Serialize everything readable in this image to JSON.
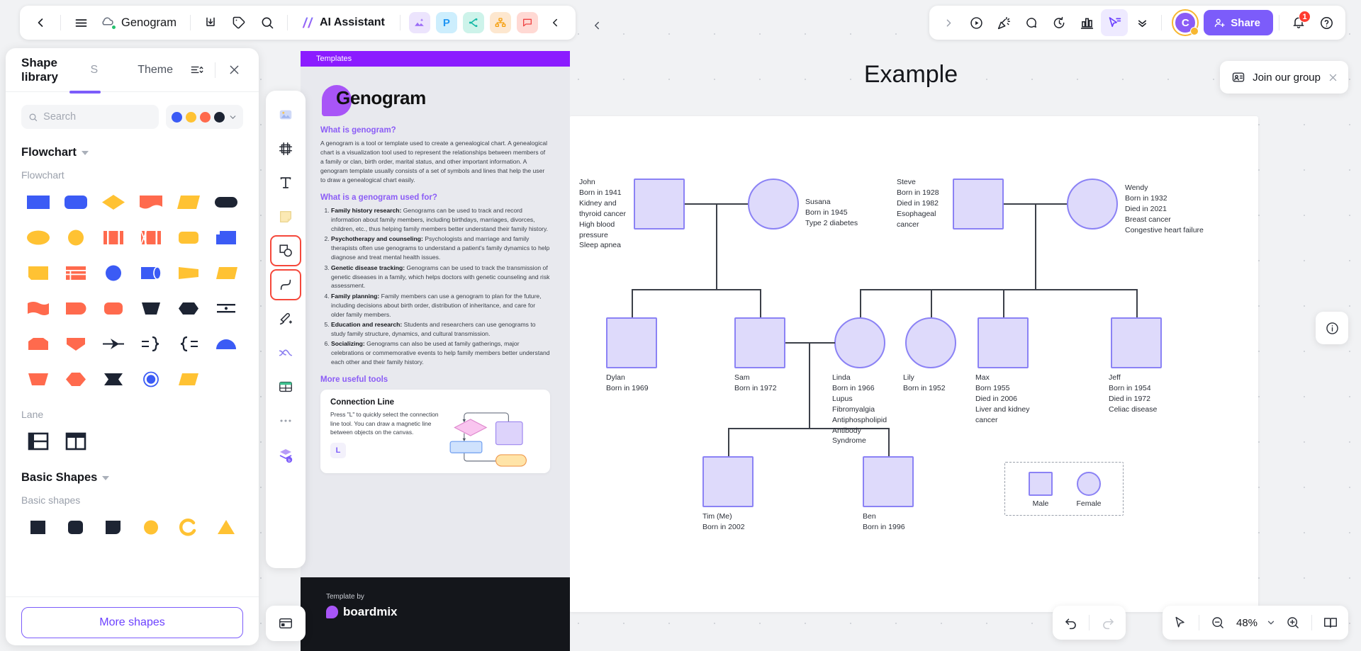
{
  "topbar": {
    "back_icon": "chevron-left-icon",
    "menu_icon": "hamburger-menu-icon",
    "cloud_icon": "cloud-saved-icon",
    "doc_title": "Genogram",
    "download_icon": "download-icon",
    "tag_icon": "tag-icon",
    "search_icon": "search-icon",
    "ai_label": "AI Assistant",
    "apps": [
      {
        "name": "image-app-icon",
        "glyph": "",
        "bg": "#ece4fd",
        "fg": "#8b5cf6"
      },
      {
        "name": "ppt-app-icon",
        "glyph": "P",
        "bg": "#cdeefd",
        "fg": "#2196f3"
      },
      {
        "name": "mind-map-app-icon",
        "glyph": "",
        "bg": "#cdf3ea",
        "fg": "#14b8a6"
      },
      {
        "name": "org-chart-app-icon",
        "glyph": "",
        "bg": "#fde7cf",
        "fg": "#f59e0b"
      },
      {
        "name": "comment-app-icon",
        "glyph": "",
        "bg": "#ffd9d4",
        "fg": "#ef4444"
      }
    ],
    "collapse_icon": "chevron-left-icon",
    "right_tools": [
      {
        "name": "chevron-right-icon"
      },
      {
        "name": "play-circle-icon"
      },
      {
        "name": "party-popper-icon"
      },
      {
        "name": "comment-bubble-icon"
      },
      {
        "name": "timer-icon"
      },
      {
        "name": "vote-chart-icon"
      },
      {
        "name": "cursor-share-icon"
      },
      {
        "name": "chevrons-down-icon"
      }
    ],
    "avatar_initial": "C",
    "share_label": "Share",
    "notification_icon": "bell-icon",
    "notification_count": "1",
    "help_icon": "help-circle-icon"
  },
  "shape_library": {
    "title": "Shape library",
    "tab_s": "S",
    "tab_theme": "Theme",
    "sort_icon": "sort-list-icon",
    "close_icon": "close-icon",
    "search_placeholder": "Search",
    "search_value": "",
    "swatches": [
      "#3b5bf5",
      "#ffc233",
      "#ff6a4d",
      "#1d2433"
    ],
    "swatch_caret_icon": "chevron-down-icon",
    "sections": [
      {
        "title": "Flowchart",
        "subtitle": "Flowchart",
        "shapes": [
          "rectangle",
          "rounded-rect",
          "diamond",
          "document",
          "parallelogram",
          "pill-dark",
          "ellipse",
          "circle",
          "predefined-process",
          "internal-storage",
          "rounded-square",
          "card",
          "note",
          "table-list",
          "circle-blue",
          "cylinder-h",
          "trapezoid-right",
          "trapezoid-yellow",
          "wave-doc",
          "terminator",
          "rounded-rect-red",
          "trapezoid-dark",
          "hexagon-dark",
          "collate",
          "home-plate",
          "shield",
          "arrow-right-line",
          "brace-right",
          "brace-left",
          "half-circle",
          "trapezoid-down",
          "heptagon",
          "flag-dark",
          "target-circle",
          "parallelogram-yellow"
        ]
      },
      {
        "title": "Lane",
        "shapes": [
          "lane-horizontal",
          "lane-vertical"
        ]
      },
      {
        "title": "Basic Shapes",
        "subtitle": "Basic shapes",
        "shapes": [
          "square-dark",
          "rounded-square-dark",
          "leaf-dark",
          "circle-yellow",
          "arc-yellow",
          "triangle-yellow"
        ]
      }
    ],
    "more_shapes_label": "More shapes"
  },
  "tool_rail": {
    "tools": [
      {
        "name": "sticky-image-tool",
        "selected": false
      },
      {
        "name": "frame-tool",
        "selected": false
      },
      {
        "name": "text-tool",
        "selected": false
      },
      {
        "name": "note-tool",
        "selected": false
      },
      {
        "name": "shape-tool",
        "selected": true
      },
      {
        "name": "connector-line-tool",
        "selected": true
      },
      {
        "name": "pen-tool",
        "selected": false
      },
      {
        "name": "curve-tool",
        "selected": false
      },
      {
        "name": "table-tool",
        "selected": false
      },
      {
        "name": "more-tool",
        "selected": false
      },
      {
        "name": "template-tool",
        "selected": false
      }
    ],
    "bottom_tool": "document-tool"
  },
  "template_doc": {
    "ribbon": "Templates",
    "brand": "Genogram",
    "h1": "What is genogram?",
    "p1": "A genogram is a tool or template used to create a genealogical chart. A genealogical chart is a visualization tool used to represent the relationships between members of a family or clan, birth order, marital status, and other important information. A genogram template usually consists of a set of symbols and lines that help the user to draw a genealogical chart easily.",
    "h2": "What is a genogram used for?",
    "list": [
      {
        "bold": "Family history research:",
        "text": " Genograms can be used to track and record information about family members, including birthdays, marriages, divorces, children, etc., thus helping family members better understand their family history."
      },
      {
        "bold": "Psychotherapy and counseling:",
        "text": " Psychologists and marriage and family therapists often use genograms to understand a patient's family dynamics to help diagnose and treat mental health issues."
      },
      {
        "bold": "Genetic disease tracking:",
        "text": " Genograms can be used to track the transmission of genetic diseases in a family, which helps doctors with genetic counseling and risk assessment."
      },
      {
        "bold": "Family planning:",
        "text": " Family members can use a genogram to plan for the future, including decisions about birth order, distribution of inheritance, and care for older family members."
      },
      {
        "bold": "Education and research:",
        "text": " Students and researchers can use genograms to study family structure, dynamics, and cultural transmission."
      },
      {
        "bold": "Socializing:",
        "text": " Genograms can also be used at family gatherings, major celebrations or commemorative events to help family members better understand each other and their family history."
      }
    ],
    "h3": "More useful tools",
    "card_title": "Connection Line",
    "card_text": "Press \"L\" to quickly select the connection line tool. You can draw a magnetic line between objects on the canvas.",
    "card_key": "L",
    "footer_small": "Template by",
    "footer_brand": "boardmix"
  },
  "board": {
    "title": "Example",
    "join_label": "Join our group",
    "join_icon": "group-icon",
    "join_close_icon": "close-icon",
    "info_icon": "info-circle-icon"
  },
  "genogram": {
    "people": [
      {
        "name": "John",
        "lines": "John\nBorn in 1941\nKidney and\nthyroid cancer\nHigh blood\npressure\nSleep apnea",
        "shape": "square"
      },
      {
        "name": "Susana",
        "lines": "Susana\nBorn in 1945\nType 2 diabetes",
        "shape": "circle"
      },
      {
        "name": "Steve",
        "lines": "Steve\nBorn in 1928\nDied in 1982\nEsophageal\ncancer",
        "shape": "square"
      },
      {
        "name": "Wendy",
        "lines": "Wendy\nBorn in 1932\nDied in 2021\nBreast cancer\nCongestive heart failure",
        "shape": "circle"
      },
      {
        "name": "Dylan",
        "lines": "Dylan\nBorn in 1969",
        "shape": "square"
      },
      {
        "name": "Sam",
        "lines": "Sam\nBorn in 1972",
        "shape": "square"
      },
      {
        "name": "Linda",
        "lines": "Linda\nBorn in 1966\nLupus\nFibromyalgia\nAntiphospholipid\nAntibody\nSyndrome",
        "shape": "circle"
      },
      {
        "name": "Lily",
        "lines": "Lily\nBorn in 1952",
        "shape": "circle"
      },
      {
        "name": "Max",
        "lines": "Max\nBorn 1955\nDied in 2006\nLiver and kidney\ncancer",
        "shape": "square"
      },
      {
        "name": "Jeff",
        "lines": "Jeff\nBorn in 1954\nDied in 1972\nCeliac disease",
        "shape": "square"
      },
      {
        "name": "Tim",
        "lines": "Tim (Me)\nBorn in 2002",
        "shape": "square"
      },
      {
        "name": "Ben",
        "lines": "Ben\nBorn in 1996",
        "shape": "square"
      }
    ],
    "legend": {
      "male": "Male",
      "female": "Female"
    }
  },
  "bottombar": {
    "undo_icon": "undo-icon",
    "redo_icon": "redo-icon",
    "pointer_icon": "pointer-icon",
    "zoom_out_icon": "zoom-out-icon",
    "zoom_value": "48%",
    "zoom_caret_icon": "chevron-down-icon",
    "zoom_in_icon": "zoom-in-icon",
    "present_icon": "present-book-icon"
  }
}
